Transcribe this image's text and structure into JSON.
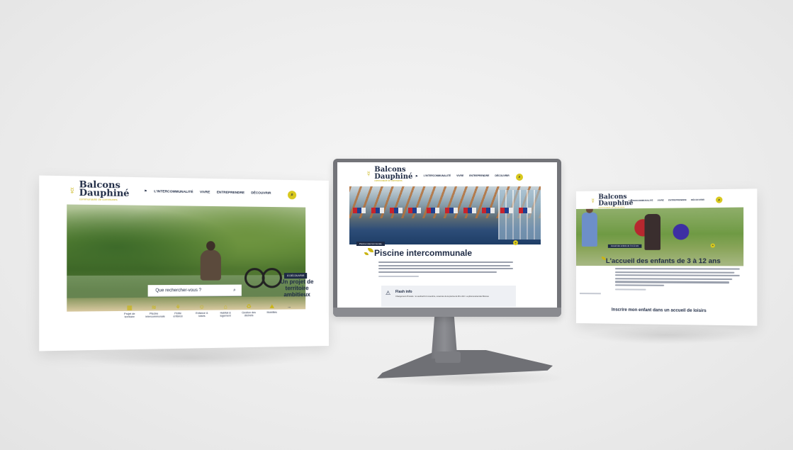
{
  "brand": {
    "name_line1": "Balcons",
    "name_line2": "Dauphiné",
    "tagline": "communauté de communes",
    "logo_mark": "☿"
  },
  "left_page": {
    "nav": [
      "L'INTERCOMMUNALITÉ",
      "VIVRE",
      "ENTREPRENDRE",
      "DÉCOUVRIR"
    ],
    "search_placeholder": "Que rechercher-vous ?",
    "hero_tag": "À DÉCOUVRIR",
    "hero_tagline": "Un projet de territoire ambitieux",
    "quick_links": [
      {
        "icon": "map-icon",
        "label": "Projet de territoire"
      },
      {
        "icon": "pool-icon",
        "label": "Piscine intercommunale"
      },
      {
        "icon": "family-icon",
        "label": "Petite enfance"
      },
      {
        "icon": "child-icon",
        "label": "Enfance & loisirs"
      },
      {
        "icon": "house-icon",
        "label": "Habitat & logement"
      },
      {
        "icon": "waste-icon",
        "label": "Gestion des déchets"
      },
      {
        "icon": "leisure-icon",
        "label": "Mobilités"
      }
    ]
  },
  "center_page": {
    "nav": [
      "L'INTERCOMMUNALITÉ",
      "VIVRE",
      "ENTREPRENDRE",
      "DÉCOUVRIR"
    ],
    "breadcrumb": "Piscine intercommunale",
    "title": "Piscine intercommunale",
    "flash_title": "Flash info",
    "flash_text": "Changement d'horaire : le vendredi 12 novembre, ouverture de la piscine de 9h à 11h. La phénoménal des Bonnes"
  },
  "right_page": {
    "nav": [
      "L'INTERCOMMUNALITÉ",
      "VIVRE",
      "ENTREPRENDRE",
      "DÉCOUVRIR"
    ],
    "breadcrumb": "Accueil des enfants de 3 à 12 ans",
    "title": "L'accueil des enfants de 3 à 12 ans",
    "cta": "Inscrire mon enfant dans un accueil de loisirs"
  },
  "colors": {
    "brand_yellow": "#d8c81e",
    "brand_navy": "#1e2a44"
  }
}
